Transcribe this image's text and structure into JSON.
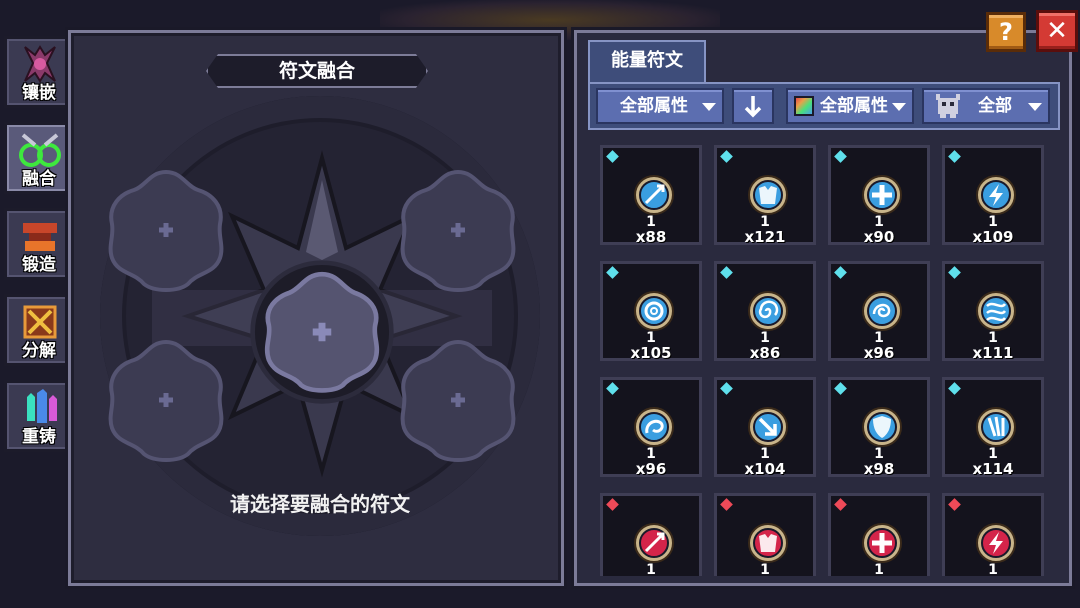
{
  "side_tabs": [
    {
      "label": "镶嵌",
      "icon": "inlay-icon",
      "active": false
    },
    {
      "label": "融合",
      "icon": "fuse-icon",
      "active": true
    },
    {
      "label": "锻造",
      "icon": "forge-icon",
      "active": false
    },
    {
      "label": "分解",
      "icon": "dismantle-icon",
      "active": false
    },
    {
      "label": "重铸",
      "icon": "recast-icon",
      "active": false
    }
  ],
  "fuse_panel": {
    "title": "符文融合",
    "hint": "请选择要融合的符文",
    "slot_count": 5
  },
  "rune_panel": {
    "tab_label": "能量符文",
    "filters": {
      "attribute_label": "全部属性",
      "sort_icon": "arrow-down-icon",
      "element_label": "全部属性",
      "type_label": "全部"
    }
  },
  "runes": [
    {
      "gem": "cyan",
      "orb": "blue",
      "symbol": "sword",
      "level": "1",
      "count": "x88"
    },
    {
      "gem": "cyan",
      "orb": "blue",
      "symbol": "armor",
      "level": "1",
      "count": "x121"
    },
    {
      "gem": "cyan",
      "orb": "blue",
      "symbol": "cross",
      "level": "1",
      "count": "x90"
    },
    {
      "gem": "cyan",
      "orb": "blue",
      "symbol": "bolt",
      "level": "1",
      "count": "x109"
    },
    {
      "gem": "cyan",
      "orb": "blue",
      "symbol": "ring",
      "level": "1",
      "count": "x105"
    },
    {
      "gem": "cyan",
      "orb": "blue",
      "symbol": "spiral",
      "level": "1",
      "count": "x86"
    },
    {
      "gem": "cyan",
      "orb": "blue",
      "symbol": "swirl",
      "level": "1",
      "count": "x96"
    },
    {
      "gem": "cyan",
      "orb": "blue",
      "symbol": "wave",
      "level": "1",
      "count": "x111"
    },
    {
      "gem": "cyan",
      "orb": "blue",
      "symbol": "hook",
      "level": "1",
      "count": "x96"
    },
    {
      "gem": "cyan",
      "orb": "blue",
      "symbol": "arrow",
      "level": "1",
      "count": "x104"
    },
    {
      "gem": "cyan",
      "orb": "blue",
      "symbol": "shield",
      "level": "1",
      "count": "x98"
    },
    {
      "gem": "cyan",
      "orb": "blue",
      "symbol": "claw",
      "level": "1",
      "count": "x114"
    },
    {
      "gem": "red",
      "orb": "red",
      "symbol": "sword",
      "level": "1",
      "count": ""
    },
    {
      "gem": "red",
      "orb": "red",
      "symbol": "armor",
      "level": "1",
      "count": ""
    },
    {
      "gem": "red",
      "orb": "red",
      "symbol": "cross",
      "level": "1",
      "count": ""
    },
    {
      "gem": "red",
      "orb": "red",
      "symbol": "bolt",
      "level": "1",
      "count": ""
    }
  ],
  "colors": {
    "gem_cyan": "#5fe0ec",
    "gem_red": "#ee4a58",
    "orb_blue": "#3a9ee0",
    "orb_red": "#d4244a",
    "orb_rim": "#c8b48a"
  },
  "top_buttons": {
    "help_label": "?",
    "close_label": "✕"
  }
}
